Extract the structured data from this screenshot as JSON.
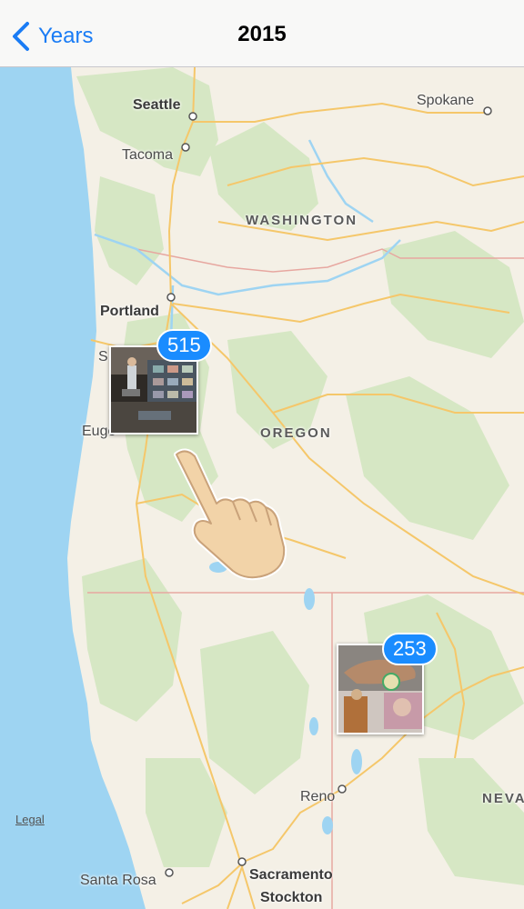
{
  "navbar": {
    "back_label": "Years",
    "title": "2015"
  },
  "map": {
    "cities": {
      "seattle": "Seattle",
      "tacoma": "Tacoma",
      "spokane": "Spokane",
      "portland": "Portland",
      "salem_partial": "S",
      "eugene_partial": "Euge",
      "reno": "Reno",
      "santa_rosa": "Santa Rosa",
      "sacramento": "Sacramento",
      "stockton": "Stockton"
    },
    "states": {
      "washington": "WASHINGTON",
      "oregon": "OREGON",
      "nevada_partial": "NEVA"
    },
    "legal_label": "Legal",
    "clusters": [
      {
        "count": "515",
        "icon": "photo-stack-icon"
      },
      {
        "count": "253",
        "icon": "photo-stack-icon"
      }
    ],
    "overlay_icon": "pointing-hand-icon",
    "colors": {
      "water": "#9ed4f2",
      "land": "#f4f0e6",
      "forest": "#d6e7c4",
      "road": "#f5c76a",
      "badge": "#1a8cff"
    }
  }
}
